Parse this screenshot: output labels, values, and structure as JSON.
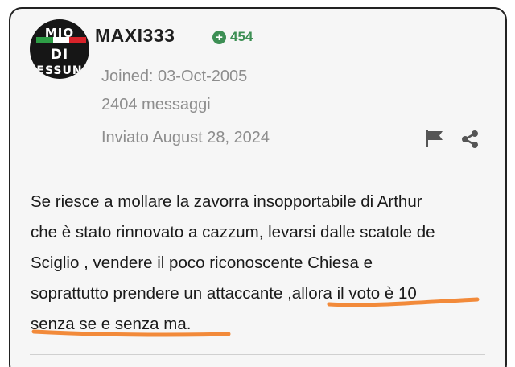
{
  "author": {
    "username": "MAXI333",
    "reputation": "454",
    "reputation_icon": "plus-circle-icon",
    "avatar_text": [
      "MIO",
      "DI",
      "ESSUN"
    ],
    "joined": "Joined: 03-Oct-2005",
    "post_count": "2404 messaggi"
  },
  "post": {
    "posted": "Inviato August 28, 2024",
    "body_paragraphs": [
      "Se riesce a mollare la zavorra insopportabile di Arthur",
      "che è stato rinnovato a cazzum, levarsi dalle scatole de",
      "Sciglio , vendere il poco riconoscente Chiesa e",
      "soprattutto prendere un attaccante ,allora il voto è 10",
      "senza se e senza ma."
    ],
    "actions": [
      "flag-icon",
      "share-icon"
    ]
  },
  "colors": {
    "reputation": "#3d8f54",
    "meta_text": "#8d8d8d",
    "highlight_underline": "#f28a3a",
    "card_border": "#222222",
    "card_bg": "#f6f6f6"
  }
}
